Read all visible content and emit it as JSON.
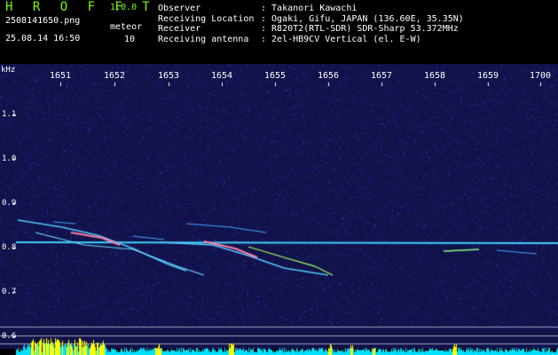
{
  "app": {
    "logo": "H R O F F T",
    "version": "1.0.0"
  },
  "file": {
    "name": "2508141650.png",
    "timestamp": "25.08.14 16:50"
  },
  "meteor": {
    "label": "meteor",
    "count": "10"
  },
  "info": [
    {
      "key": "Observer",
      "value": ": Takanori Kawachi"
    },
    {
      "key": "Receiving Location",
      "value": ": Ogaki, Gifu, JAPAN (136.60E, 35.35N)"
    },
    {
      "key": "Receiver",
      "value": ": R820T2(RTL-SDR) SDR-Sharp 53.372MHz"
    },
    {
      "key": "Receiving antenna",
      "value": ": 2el-HB9CV Vertical (el. E-W)"
    }
  ],
  "axis": {
    "x_unit": "kHz",
    "x_ticks": [
      "1651",
      "1652",
      "1653",
      "1654",
      "1655",
      "1656",
      "1657",
      "1658",
      "1659",
      "1700"
    ],
    "y_ticks": [
      "1.1",
      "1.0",
      "0.9",
      "0.8",
      "0.7",
      "0.6"
    ]
  },
  "colors": {
    "background": "#12124a",
    "logo": "#7cfc00",
    "carrier": "#40d0ff",
    "histogram": "#00e0ff",
    "peak": "#ffff00"
  }
}
